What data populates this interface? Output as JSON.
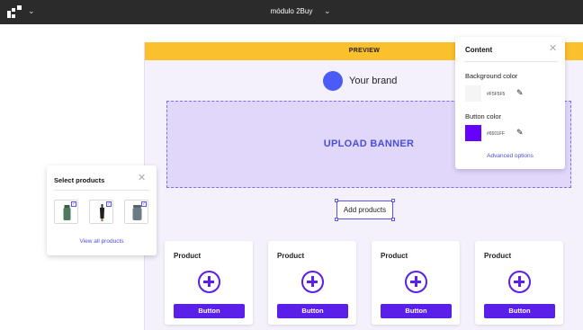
{
  "topbar": {
    "module_title": "módulo 2Buy"
  },
  "preview": {
    "label": "PREVIEW",
    "brand_name": "Your brand",
    "brand_color": "#4a5cf5",
    "banner_label": "UPLOAD BANNER",
    "add_products_label": "Add products",
    "cards": [
      {
        "title": "Product",
        "button": "Button"
      },
      {
        "title": "Product",
        "button": "Button"
      },
      {
        "title": "Product",
        "button": "Button"
      },
      {
        "title": "Product",
        "button": "Button"
      }
    ]
  },
  "content_panel": {
    "title": "Content",
    "background_label": "Background color",
    "background_hex": "#F5F5F5",
    "button_label": "Button color",
    "button_hex": "#6501FF",
    "advanced_link": "Advanced options"
  },
  "select_products": {
    "title": "Select products",
    "view_all": "View all products"
  },
  "colors": {
    "accent": "#5a1fe8",
    "preview_bar": "#fbc02d",
    "banner": "#e0d7fb"
  }
}
